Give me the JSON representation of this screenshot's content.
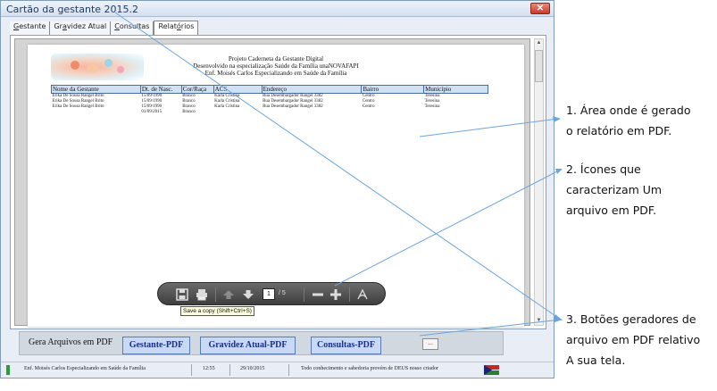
{
  "window": {
    "title": "Cartão da gestante 2015.2",
    "close_glyph": "✕"
  },
  "tabs": [
    {
      "pre": "",
      "u": "G",
      "post": "estante"
    },
    {
      "pre": "Gr",
      "u": "a",
      "post": "videz Atual"
    },
    {
      "pre": "",
      "u": "C",
      "post": "onsultas"
    },
    {
      "pre": "Relat",
      "u": "ó",
      "post": "rios"
    }
  ],
  "report": {
    "header_lines": [
      "Projeto Caderneta da Gestante Digital",
      "Desenvolvido na especialização Saúde da Família unaNOVAFAPI",
      "Enf. Moisés Carlos Especializando em Saúde da Família"
    ],
    "columns": [
      "Nome da Gestante",
      "Dt. de Nasc.",
      "Cor/Raça",
      "ACS",
      "Endereço",
      "Bairro",
      "Município"
    ],
    "rows": [
      [
        "Erika De Sousa Rangel Brito",
        "15/09/1990",
        "Branco",
        "Karla Cristina",
        "Rua Desembargador Rangel 3382",
        "Centro",
        "Teresina"
      ],
      [
        "Erika De Sousa Rangel Brito",
        "15/09/1990",
        "Branco",
        "Karla Cristina",
        "Rua Desembargador Rangel 3382",
        "Centro",
        "Teresina"
      ],
      [
        "Erika De Sousa Rangel Brito",
        "15/09/1990",
        "Branco",
        "Karla Cristina",
        "Rua Desembargador Rangel 3382",
        "Centro",
        "Teresina"
      ],
      [
        "",
        "01/09/2015",
        "Branco",
        "",
        "",
        "",
        ""
      ]
    ]
  },
  "pdf_toolbar": {
    "icons": [
      "save-icon",
      "print-icon",
      "page-up-icon",
      "page-down-icon",
      "zoom-out-icon",
      "zoom-in-icon",
      "adobe-sign-icon"
    ],
    "current_page": "1",
    "total_pages": "/ 5",
    "tooltip": "Save a copy (Shift+Ctrl+S)"
  },
  "bottom_bar": {
    "label": "Gera Arquivos em PDF",
    "buttons": [
      "Gestante-PDF",
      "Gravidez Atual-PDF",
      "Consultas-PDF"
    ],
    "more": "..."
  },
  "status_bar": {
    "author": "Enf. Moisés Carlos Especializando em Saúde da Família",
    "time": "12:55",
    "date": "29/10/2015",
    "motto": "Todo conhecimento e sabedoria provém de DEUS nosso criador"
  },
  "annotations": {
    "note1": [
      "1.   Área onde é gerado",
      "o relatório em PDF."
    ],
    "note2": [
      "2. Ícones que",
      "caracterizam Um",
      "arquivo em PDF."
    ],
    "note3": [
      "3. Botões geradores de",
      "arquivo em PDF relativo",
      "A sua tela."
    ],
    "line_color": "#6aa6de"
  },
  "colors": {
    "table_header_bg": "#cfe1f3",
    "button_bg": "#c7d9f5",
    "button_text": "#1b2f8a"
  }
}
